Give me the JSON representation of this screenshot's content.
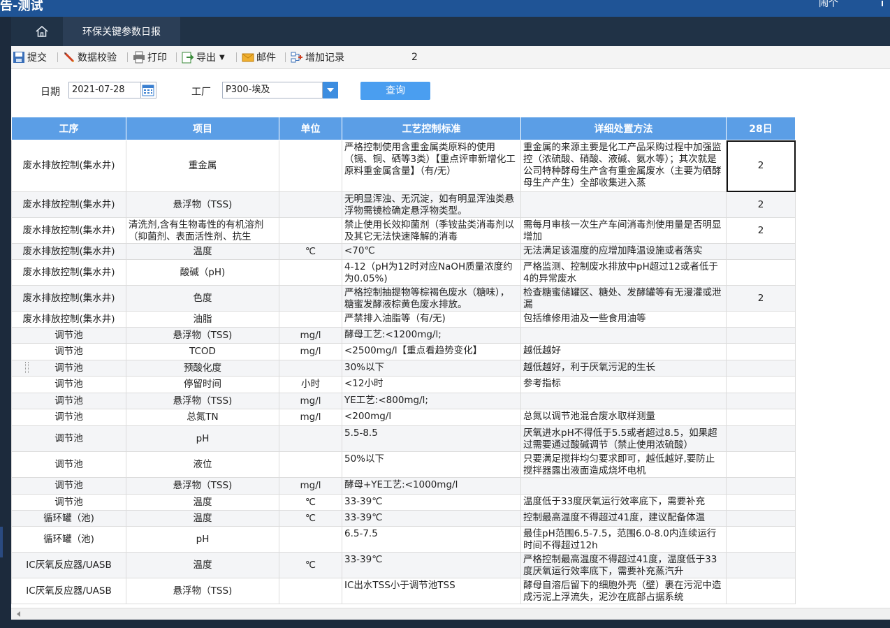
{
  "app": {
    "title": "告-测试",
    "user": "闹个"
  },
  "tabs": {
    "report_label": "环保关键参数日报"
  },
  "toolbar": {
    "submit": "提交",
    "validate": "数据校验",
    "print": "打印",
    "export": "导出",
    "mail": "邮件",
    "add_record": "增加记录",
    "count": "2"
  },
  "filter": {
    "date_label": "日期",
    "date_value": "2021-07-28",
    "plant_label": "工厂",
    "plant_value": "P300-埃及",
    "query_label": "查询"
  },
  "colors": {
    "header": "#5b9ee6",
    "accent": "#1f5496",
    "query": "#4a9ef0"
  },
  "grid": {
    "headers": [
      "工序",
      "项目",
      "单位",
      "工艺控制标准",
      "详细处置方法",
      "28日"
    ],
    "rows": [
      [
        "废水排放控制(集水井)",
        "重金属",
        "",
        "严格控制使用含重金属类原料的使用（镉、铜、硒等3类）【重点评审新增化工原料重金属含量】（有/无）",
        "重金属的来源主要是化工产品采购过程中加强监控（浓硫酸、硝酸、液碱、氨水等）；其次就是公司特种酵母生产含有重金属废水（主要为硒酵母生产产生）全部收集进入蒸",
        "2"
      ],
      [
        "废水排放控制(集水井)",
        "悬浮物（TSS)",
        "",
        "无明显浑浊、无沉淀，如有明显浑浊类悬浮物需镜检确定悬浮物类型。",
        "",
        "2"
      ],
      [
        "废水排放控制(集水井)",
        "清洗剂,含有生物毒性的有机溶剂（抑菌剂、表面活性剂、抗生",
        "",
        "禁止使用长效抑菌剂（季铵盐类消毒剂以及其它无法快速降解的消毒",
        "需每月审核一次生产车间消毒剂使用量是否明显增加",
        "2"
      ],
      [
        "废水排放控制(集水井)",
        "温度",
        "℃",
        "<70℃",
        "无法满足该温度的应增加降温设施或者落实",
        ""
      ],
      [
        "废水排放控制(集水井)",
        "酸碱（pH)",
        "",
        "4-12（pH为12时对应NaOH质量浓度约为0.05%)",
        "严格监测、控制废水排放中pH超过12或者低于4的异常废水",
        ""
      ],
      [
        "废水排放控制(集水井)",
        "色度",
        "",
        "严格控制抽提物等棕褐色废水（糖味），糖蜜发酵液棕黄色废水排放。",
        "检查糖蜜储罐区、糖处、发酵罐等有无漫灌或泄漏",
        "2"
      ],
      [
        "废水排放控制(集水井)",
        "油脂",
        "",
        "严禁排入油脂等（有/无)",
        "包括维修用油及一些食用油等",
        ""
      ],
      [
        "调节池",
        "悬浮物（TSS)",
        "mg/l",
        "酵母工艺:<1200mg/l;",
        "",
        ""
      ],
      [
        "调节池",
        "TCOD",
        "mg/l",
        "<2500mg/l【重点看趋势变化】",
        "越低越好",
        ""
      ],
      [
        "调节池",
        "预酸化度",
        "",
        "30%以下",
        "越低越好，利于厌氧污泥的生长",
        ""
      ],
      [
        "调节池",
        "停留时间",
        "小时",
        "<12小时",
        "参考指标",
        ""
      ],
      [
        "调节池",
        "悬浮物（TSS)",
        "mg/l",
        "YE工艺:<800mg/l;",
        "",
        ""
      ],
      [
        "调节池",
        "总氮TN",
        "mg/l",
        "<200mg/l",
        "总氮以调节池混合废水取样测量",
        ""
      ],
      [
        "调节池",
        "pH",
        "",
        "5.5-8.5",
        "厌氧进水pH不得低于5.5或者超过8.5，如果超过需要通过酸碱调节（禁止使用浓硫酸）",
        ""
      ],
      [
        "调节池",
        "液位",
        "",
        "50%以下",
        "只要满足搅拌均匀要求即可，越低越好,要防止搅拌器露出液面造成烧坏电机",
        ""
      ],
      [
        "调节池",
        "悬浮物（TSS)",
        "mg/l",
        "酵母+YE工艺:<1000mg/l",
        "",
        ""
      ],
      [
        "调节池",
        "温度",
        "℃",
        "33-39℃",
        "温度低于33度厌氧运行效率底下，需要补充",
        ""
      ],
      [
        "循环罐（池)",
        "温度",
        "℃",
        "33-39℃",
        "控制最高温度不得超过41度，建议配备体温",
        ""
      ],
      [
        "循环罐（池)",
        "pH",
        "",
        "6.5-7.5",
        "最佳pH范围6.5-7.5，范围6.0-8.0内连续运行时间不得超过12h",
        ""
      ],
      [
        "IC厌氧反应器/UASB",
        "温度",
        "℃",
        "33-39℃",
        "严格控制最高温度不得超过41度，温度低于33度厌氧运行效率底下，需要补充蒸汽升",
        ""
      ],
      [
        "IC厌氧反应器/UASB",
        "悬浮物（TSS)",
        "",
        "IC出水TSS小于调节池TSS",
        "酵母自溶后留下的细胞外壳（壁）裹在污泥中造成污泥上浮流失，泥沙在底部占据系统",
        ""
      ]
    ]
  }
}
